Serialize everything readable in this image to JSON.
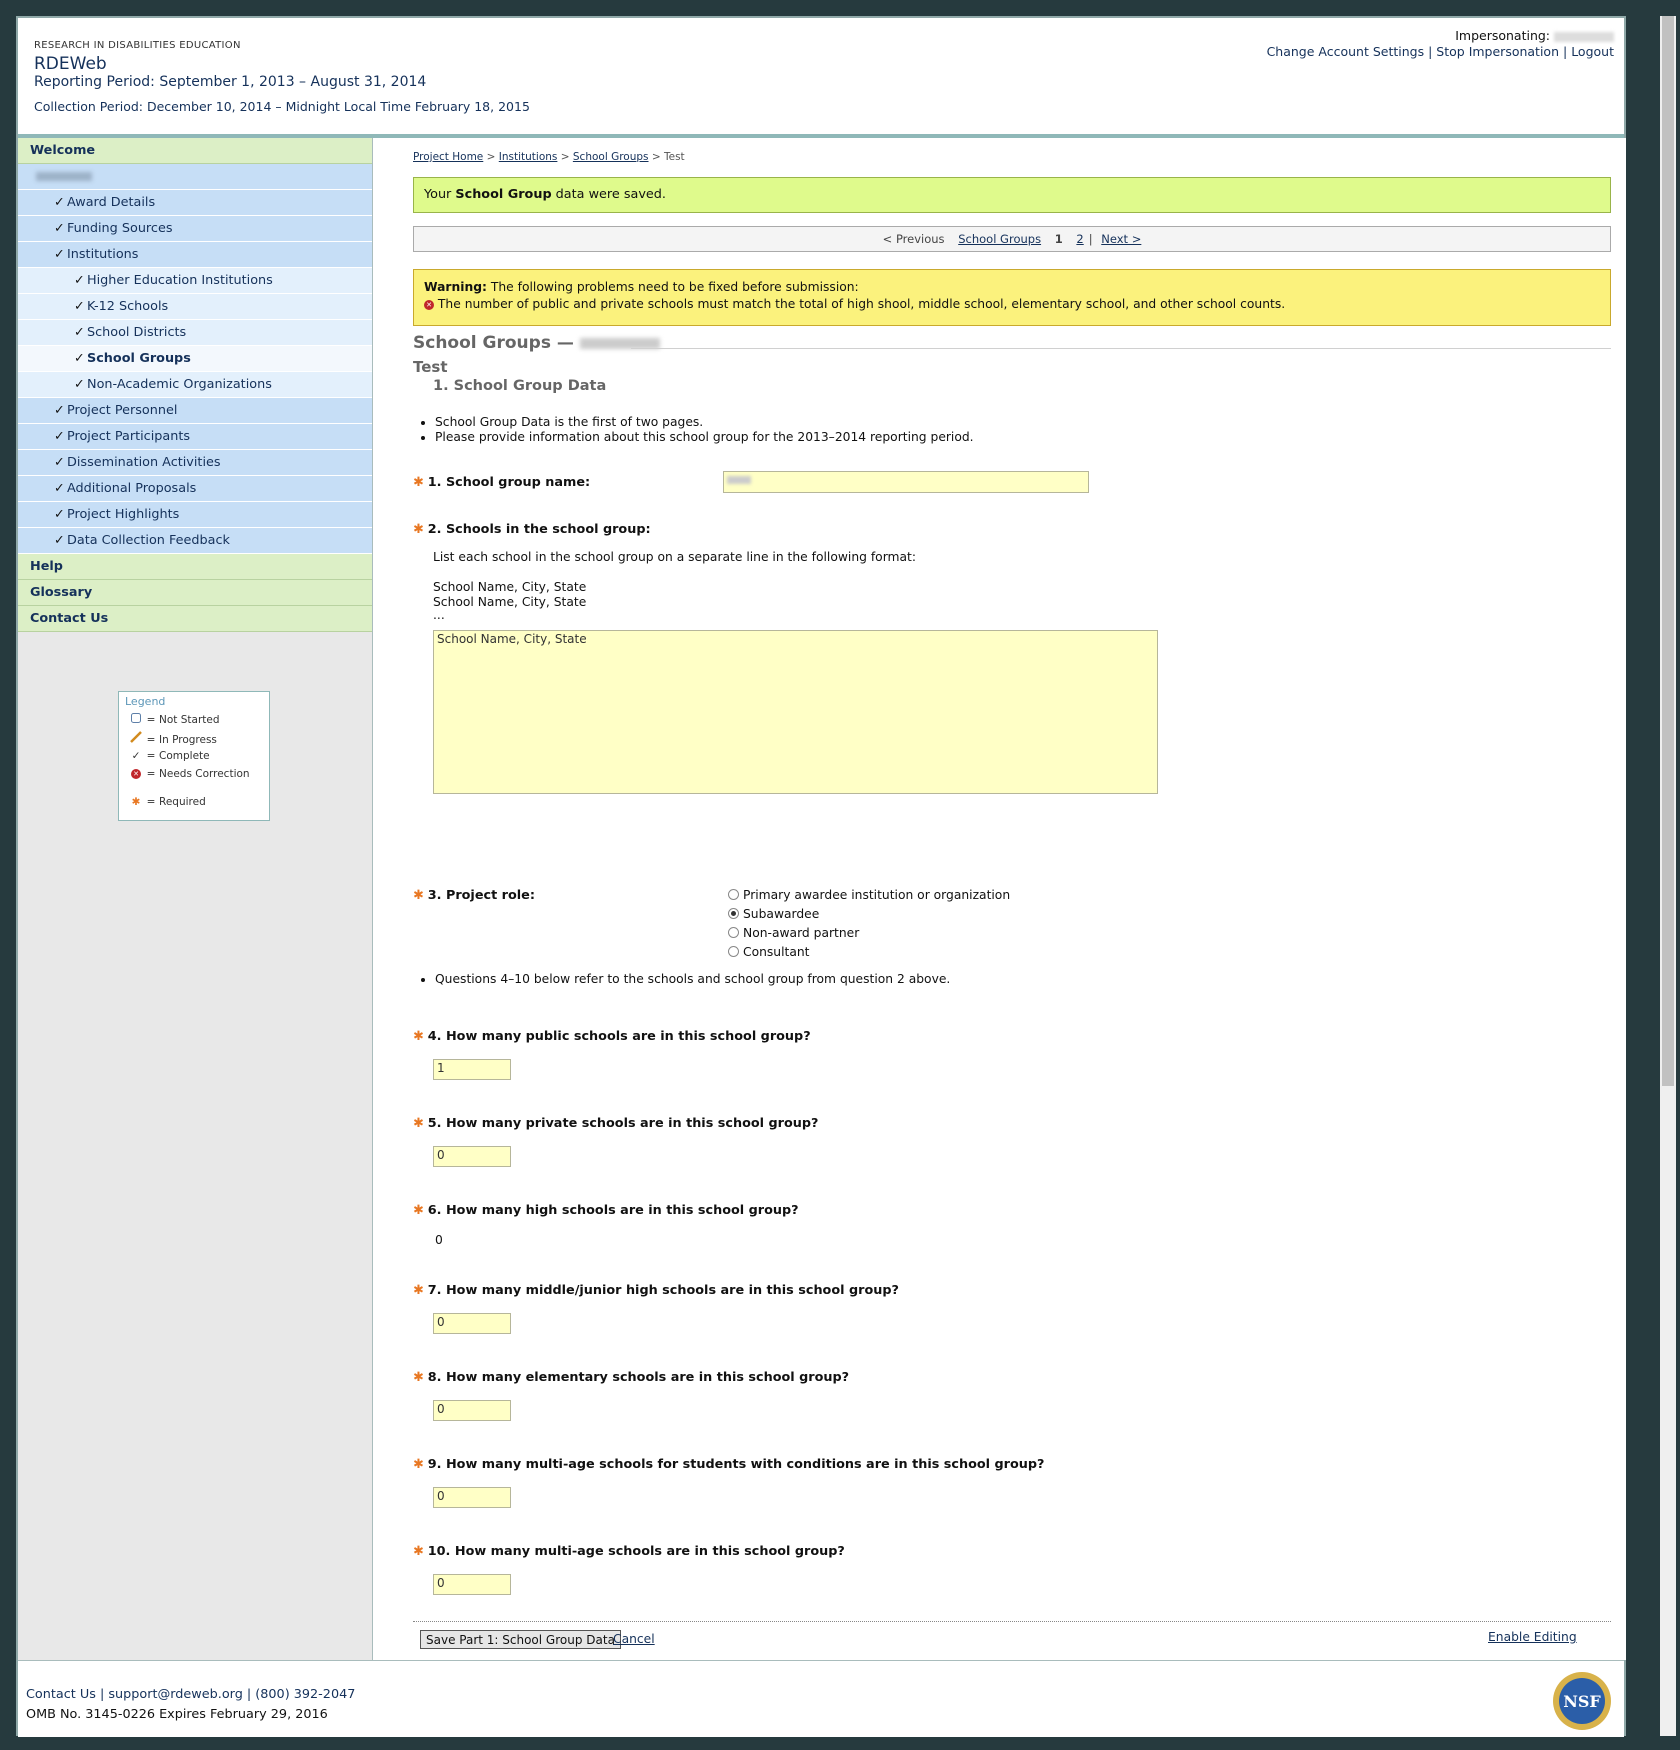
{
  "header": {
    "org": "RESEARCH IN DISABILITIES EDUCATION",
    "app_title": "RDEWeb",
    "reporting_period": "Reporting Period: September 1, 2013 – August 31, 2014",
    "collection_period": "Collection Period: December 10, 2014 – Midnight Local Time February 18, 2015",
    "impersonating_label": "Impersonating:",
    "links": [
      "Change Account Settings",
      "Stop Impersonation",
      "Logout"
    ]
  },
  "sidebar": {
    "welcome": "Welcome",
    "items": [
      "Award Details",
      "Funding Sources",
      "Institutions"
    ],
    "institutions_sub": [
      "Higher Education Institutions",
      "K-12 Schools",
      "School Districts",
      "School Groups",
      "Non-Academic Organizations"
    ],
    "items2": [
      "Project Personnel",
      "Project Participants",
      "Dissemination Activities",
      "Additional Proposals",
      "Project Highlights",
      "Data Collection Feedback"
    ],
    "bottom": [
      "Help",
      "Glossary",
      "Contact Us"
    ]
  },
  "legend": {
    "title": "Legend",
    "rows": [
      "Not Started",
      "In Progress",
      "Complete",
      "Needs Correction",
      "Required"
    ]
  },
  "breadcrumb": [
    "Project Home",
    "Institutions",
    "School Groups",
    "Test"
  ],
  "success": {
    "prefix": "Your ",
    "bold": "School Group",
    "suffix": " data were saved."
  },
  "pager": {
    "previous": "< Previous",
    "school_groups": "School Groups",
    "page1": "1",
    "page2": "2",
    "next": "Next >"
  },
  "warning": {
    "label": "Warning:",
    "text": "The following problems need to be fixed before submission:",
    "item": "The number of public and private schools must match the total of high shool, middle school, elementary school, and other school counts."
  },
  "section": {
    "title": "School Groups —",
    "subtitle": "Test",
    "part": "1. School Group Data"
  },
  "intro_bullets": [
    "School Group Data is the first of two pages.",
    "Please provide information about this school group for the 2013–2014 reporting period."
  ],
  "q1": {
    "label": "1. School group name:"
  },
  "q2": {
    "label": "2. Schools in the school group:",
    "instructions": "List each school in the school group on a separate line in the following format:",
    "example1": "School Name, City, State",
    "example2": "School Name, City, State",
    "example3": "...",
    "value": "School Name, City, State"
  },
  "q3": {
    "label": "3. Project role:",
    "options": [
      "Primary awardee institution or organization",
      "Subawardee",
      "Non-award partner",
      "Consultant"
    ],
    "selected": "Subawardee"
  },
  "note": "Questions 4–10 below refer to the schools and school group from question 2 above.",
  "q4": {
    "label": "4. How many public schools are in this school group?",
    "value": "1"
  },
  "q5": {
    "label": "5. How many private schools are in this school group?",
    "value": "0"
  },
  "q6": {
    "label": "6. How many high schools are in this school group?",
    "value": "0"
  },
  "q7": {
    "label": "7. How many middle/junior high schools are in this school group?",
    "value": "0"
  },
  "q8": {
    "label": "8. How many elementary schools are in this school group?",
    "value": "0"
  },
  "q9": {
    "label": "9. How many multi-age schools for students with conditions are in this school group?",
    "value": "0"
  },
  "q10": {
    "label": "10. How many multi-age schools are in this school group?",
    "value": "0"
  },
  "actions": {
    "save": "Save Part 1: School Group Data",
    "cancel": "Cancel",
    "enable": "Enable Editing"
  },
  "footer": {
    "contact": "Contact Us",
    "email": "support@rdeweb.org",
    "phone": "(800) 392-2047",
    "omb": "OMB No. 3145-0226 Expires February 29, 2016",
    "logo_text": "NSF"
  },
  "colors": {
    "accent": "#15315a",
    "success_bg": "#dffa8c",
    "warning_bg": "#fbf27d",
    "required": "#e87722",
    "field_bg": "#ffffc6"
  }
}
